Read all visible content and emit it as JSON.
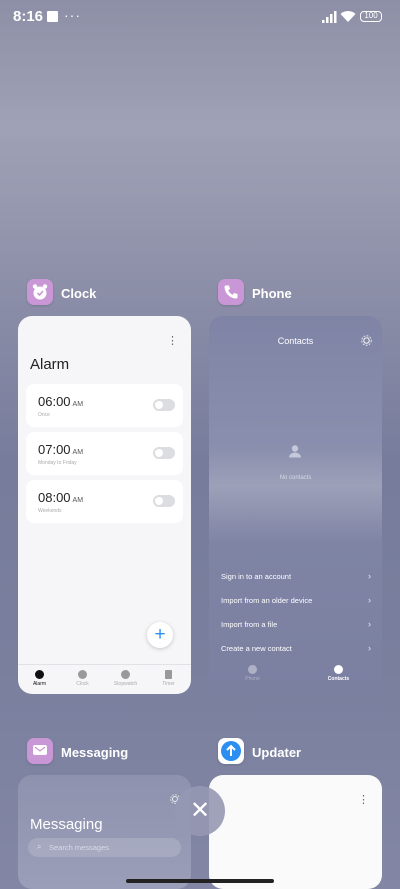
{
  "status_bar": {
    "time": "8:16",
    "dots": "···",
    "battery": "100"
  },
  "apps": {
    "clock": {
      "name": "Clock",
      "screen": {
        "title": "Alarm",
        "menu": "⋮",
        "alarms": [
          {
            "time": "06:00",
            "ampm": "AM",
            "sub": "Once",
            "on": false
          },
          {
            "time": "07:00",
            "ampm": "AM",
            "sub": "Monday to Friday",
            "on": false
          },
          {
            "time": "08:00",
            "ampm": "AM",
            "sub": "Weekends",
            "on": false
          }
        ],
        "fab": "+",
        "tabs": [
          "Alarm",
          "Clock",
          "Stopwatch",
          "Timer"
        ],
        "active_tab": "Alarm"
      }
    },
    "phone": {
      "name": "Phone",
      "screen": {
        "title": "Contacts",
        "empty": "No contacts",
        "options": [
          "Sign in to an account",
          "Import from an older device",
          "Import from a file",
          "Create a new contact"
        ],
        "tabs": [
          "Phone",
          "Contacts"
        ],
        "active_tab": "Contacts"
      }
    },
    "messaging": {
      "name": "Messaging",
      "screen": {
        "title": "Messaging",
        "search_placeholder": "Search messages"
      }
    },
    "updater": {
      "name": "Updater",
      "screen": {
        "menu": "⋮"
      }
    }
  },
  "controls": {
    "close_all": "✕"
  },
  "colors": {
    "accent": "#2b8ef0",
    "clock_icon": "#c997d6",
    "phone_icon": "#c997d6",
    "messaging_icon": "#c997d6",
    "updater_icon": "#2b8ef0"
  }
}
